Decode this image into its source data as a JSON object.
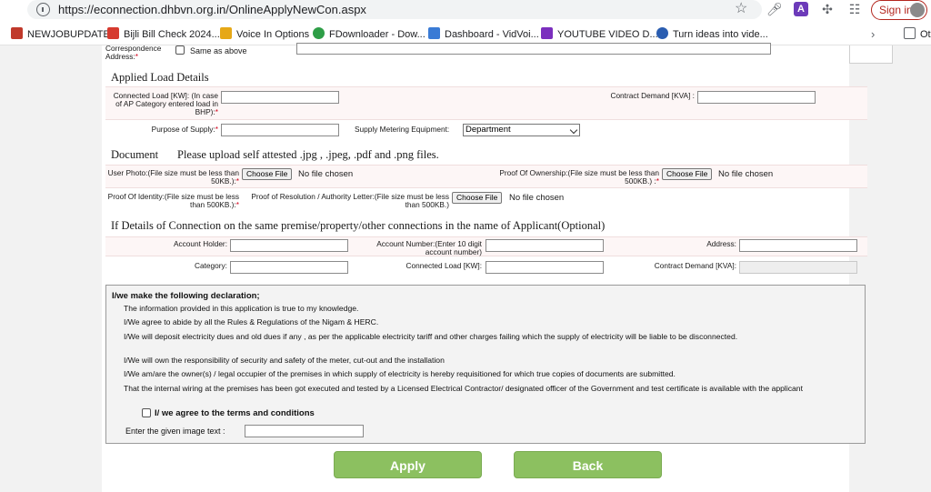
{
  "browser": {
    "url": "https://econnection.dhbvn.org.in/OnlineApplyNewCon.aspx",
    "signin_label": "Sign in",
    "extension_letter": "A",
    "bookmarks": [
      {
        "label": "NEWJOBUPDATE",
        "color": "#c0392b"
      },
      {
        "label": "Bijli Bill Check 2024...",
        "color": "#d63a2f"
      },
      {
        "label": "Voice In Options",
        "color": "#e6a817"
      },
      {
        "label": "FDownloader - Dow...",
        "color": "#2e9e47"
      },
      {
        "label": "Dashboard - VidVoi...",
        "color": "#3a7bd5"
      },
      {
        "label": "YOUTUBE VIDEO D...",
        "color": "#7b2fbe"
      },
      {
        "label": "Turn ideas into vide...",
        "color": "#2a5db0"
      }
    ],
    "other_bookmarks_label": "Ot"
  },
  "correspondence": {
    "label": "Correspondence Address:",
    "same_as_above": "Same as above"
  },
  "applied_load": {
    "title": "Applied Load Details",
    "connected_load_label": "Connected Load [KW]: (In case of AP Category entered load in BHP):",
    "contract_demand_label": "Contract Demand [KVA] :",
    "purpose_label": "Purpose of Supply:",
    "metering_label": "Supply Metering Equipment:",
    "metering_value": "Department"
  },
  "document": {
    "title": "Document",
    "instruction": "Please upload self attested .jpg , .jpeg, .pdf and .png files.",
    "user_photo_label": "User Photo:(File size must be less than 50KB.):",
    "ownership_label": "Proof Of Ownership:(File size must be less than 500KB.) :",
    "identity_label": "Proof Of Identity:(File size must be less than 500KB.):",
    "resolution_label": "Proof of Resolution / Authority Letter:(File size must be less than 500KB.)",
    "choose_file": "Choose File",
    "no_file": "No file chosen"
  },
  "other_connections": {
    "title": "If Details of Connection on the same premise/property/other connections in the name of Applicant(Optional)",
    "account_holder": "Account Holder:",
    "account_number": "Account Number:(Enter 10 digit account number)",
    "address": "Address:",
    "category": "Category:",
    "connected_load": "Connected Load [KW]:",
    "contract_demand": "Contract Demand [KVA]:"
  },
  "declaration": {
    "heading": "I/we make the following declaration;",
    "lines": [
      "The information provided in this application is true to my knowledge.",
      "I/We agree to abide by all the Rules & Regulations of the Nigam & HERC.",
      "I/We will deposit electricity dues and old dues if any , as per the applicable electricity tariff and other charges failing which the supply of electricity will be liable to be disconnected.",
      "I/We will own the responsibility of security and safety of the meter, cut-out and the installation",
      "I/We am/are the owner(s) / legal occupier of the premises in which supply of electricity is hereby requisitioned for which true copies of documents are submitted.",
      "That the internal wiring at the premises has been got executed and tested by a Licensed Electrical Contractor/ designated officer of the Government and test certificate is available with the applicant"
    ],
    "agree_label": "I/ we agree to the terms and conditions",
    "captcha_label": "Enter the given image text :"
  },
  "actions": {
    "apply": "Apply",
    "back": "Back"
  }
}
